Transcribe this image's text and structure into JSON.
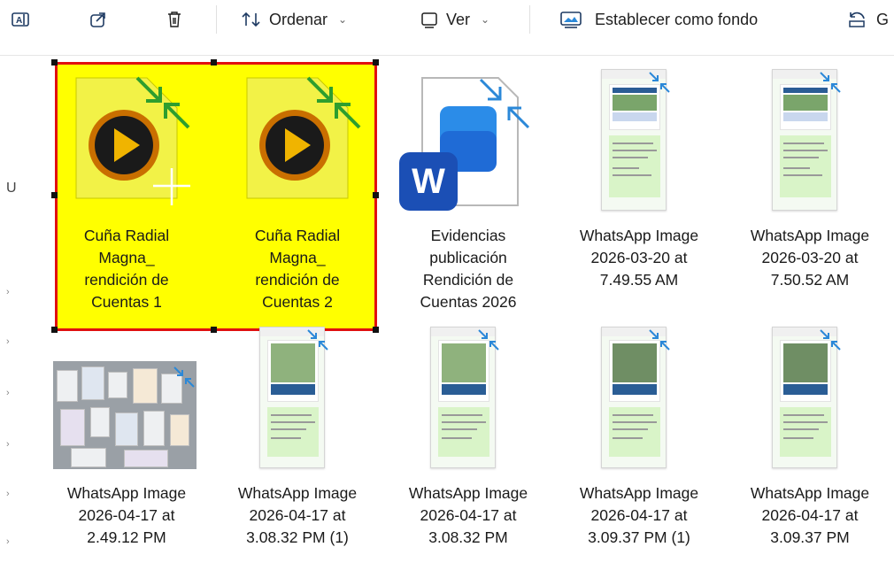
{
  "toolbar": {
    "sort_label": "Ordenar",
    "view_label": "Ver",
    "set_background_label": "Establecer como fondo",
    "truncated_label": "G"
  },
  "nav": {
    "letter": "U"
  },
  "colors": {
    "selection_fill": "#ffff00",
    "selection_border": "#e01010",
    "accent": "#2b88d8"
  },
  "files": [
    {
      "name_lines": [
        "Cuña Radial",
        "Magna_",
        "rendición de",
        "Cuentas 1"
      ],
      "type": "video",
      "selected": true
    },
    {
      "name_lines": [
        "Cuña Radial",
        "Magna_",
        "rendición de",
        "Cuentas 2"
      ],
      "type": "video",
      "selected": true
    },
    {
      "name_lines": [
        "Evidencias",
        "publicación",
        "Rendición de",
        "Cuentas 2026"
      ],
      "type": "word",
      "selected": false
    },
    {
      "name_lines": [
        "WhatsApp Image",
        "2026-03-20 at",
        "7.49.55 AM"
      ],
      "type": "image",
      "selected": false
    },
    {
      "name_lines": [
        "WhatsApp Image",
        "2026-03-20 at",
        "7.50.52 AM"
      ],
      "type": "image",
      "selected": false
    },
    {
      "name_lines": [
        "WhatsApp Image",
        "2026-04-17 at",
        "2.49.12 PM"
      ],
      "type": "image",
      "selected": false
    },
    {
      "name_lines": [
        "WhatsApp Image",
        "2026-04-17 at",
        "3.08.32 PM (1)"
      ],
      "type": "image",
      "selected": false
    },
    {
      "name_lines": [
        "WhatsApp Image",
        "2026-04-17 at",
        "3.08.32 PM"
      ],
      "type": "image",
      "selected": false
    },
    {
      "name_lines": [
        "WhatsApp Image",
        "2026-04-17 at",
        "3.09.37 PM (1)"
      ],
      "type": "image",
      "selected": false
    },
    {
      "name_lines": [
        "WhatsApp Image",
        "2026-04-17 at",
        "3.09.37 PM"
      ],
      "type": "image",
      "selected": false
    }
  ]
}
